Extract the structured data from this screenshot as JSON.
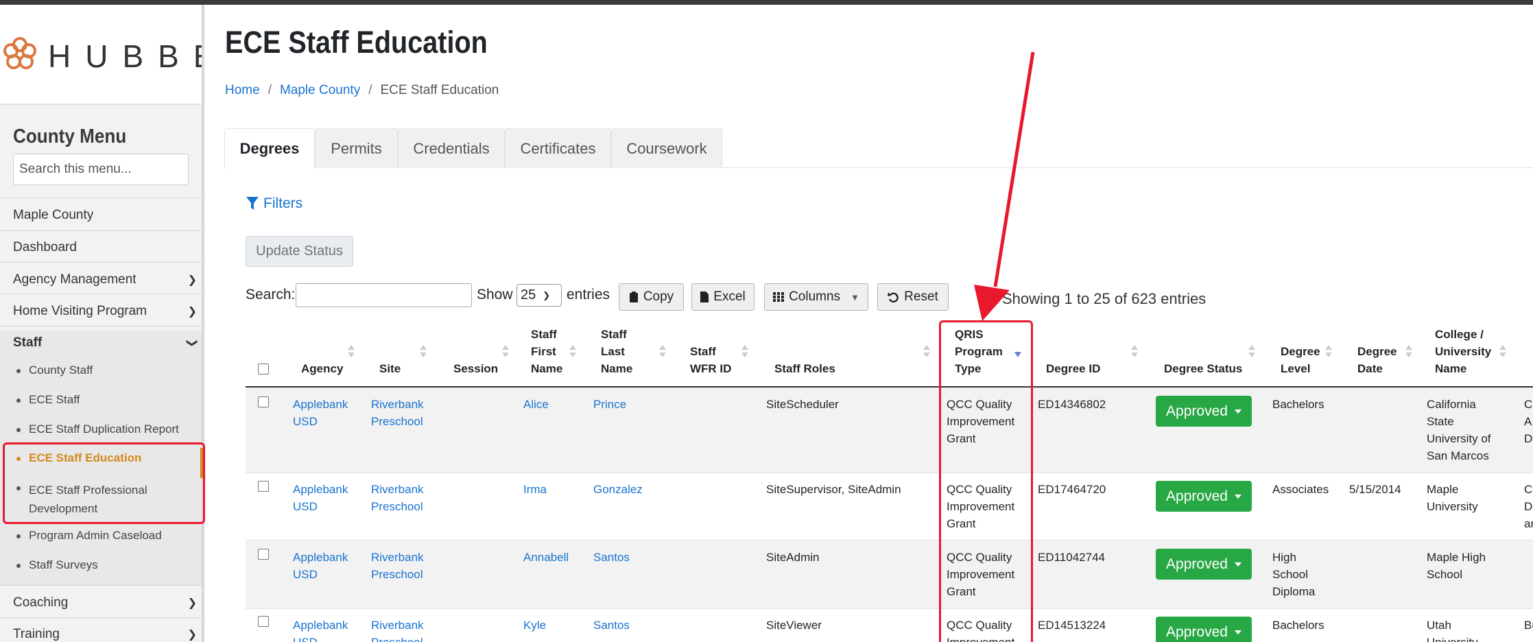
{
  "app": {
    "logo_text": "HUBBE"
  },
  "sidebar": {
    "title": "County Menu",
    "search_placeholder": "Search this menu...",
    "items": [
      {
        "label": "Maple County"
      },
      {
        "label": "Dashboard"
      },
      {
        "label": "Agency Management"
      },
      {
        "label": "Home Visiting Program"
      },
      {
        "label": "Staff"
      },
      {
        "label": "Coaching"
      },
      {
        "label": "Training"
      }
    ],
    "staff_sub": [
      {
        "label": "County Staff"
      },
      {
        "label": "ECE Staff"
      },
      {
        "label": "ECE Staff Duplication Report"
      },
      {
        "label": "ECE Staff Education"
      },
      {
        "label": "ECE Staff Professional Development"
      },
      {
        "label": "Program Admin Caseload"
      },
      {
        "label": "Staff Surveys"
      }
    ]
  },
  "page": {
    "title": "ECE Staff Education",
    "breadcrumb": [
      "Home",
      "Maple County",
      "ECE Staff Education"
    ]
  },
  "tabs": [
    "Degrees",
    "Permits",
    "Credentials",
    "Certificates",
    "Coursework"
  ],
  "toolbar": {
    "filters": "Filters",
    "update_status": "Update Status",
    "search_label": "Search:",
    "show_label": "Show",
    "show_value": "25",
    "entries_label": "entries",
    "copy": "Copy",
    "excel": "Excel",
    "columns": "Columns",
    "reset": "Reset",
    "info": "Showing 1 to 25 of 623 entries"
  },
  "table": {
    "headers": {
      "agency": "Agency",
      "site": "Site",
      "session": "Session",
      "first": [
        "Staff",
        "First",
        "Name"
      ],
      "last": [
        "Staff",
        "Last",
        "Name"
      ],
      "wfr": [
        "Staff",
        "WFR ID"
      ],
      "roles": "Staff Roles",
      "qris": [
        "QRIS",
        "Program",
        "Type"
      ],
      "degree_id": "Degree ID",
      "status": "Degree Status",
      "level": [
        "Degree",
        "Level"
      ],
      "date": [
        "Degree",
        "Date"
      ],
      "college": [
        "College /",
        "University",
        "Name"
      ]
    },
    "rows": [
      {
        "agency": [
          "Applebank",
          "USD"
        ],
        "site": [
          "Riverbank",
          "Preschool"
        ],
        "first": "Alice",
        "last": "Prince",
        "roles": "SiteScheduler",
        "qris": [
          "QCC Quality",
          "Improvement",
          "Grant"
        ],
        "degree_id": "ED14346802",
        "status": "Approved",
        "level": [
          "Bachelors"
        ],
        "date": "",
        "college": [
          "California",
          "State",
          "University of",
          "San Marcos"
        ],
        "extra": [
          "Cl",
          "A",
          "D"
        ]
      },
      {
        "agency": [
          "Applebank",
          "USD"
        ],
        "site": [
          "Riverbank",
          "Preschool"
        ],
        "first": "Irma",
        "last": "Gonzalez",
        "roles": "SiteSupervisor, SiteAdmin",
        "qris": [
          "QCC Quality",
          "Improvement",
          "Grant"
        ],
        "degree_id": "ED17464720",
        "status": "Approved",
        "level": [
          "Associates"
        ],
        "date": "5/15/2014",
        "college": [
          "Maple",
          "University"
        ],
        "extra": [
          "Cl",
          "D",
          "ar"
        ]
      },
      {
        "agency": [
          "Applebank",
          "USD"
        ],
        "site": [
          "Riverbank",
          "Preschool"
        ],
        "first": "Annabell",
        "last": "Santos",
        "roles": "SiteAdmin",
        "qris": [
          "QCC Quality",
          "Improvement",
          "Grant"
        ],
        "degree_id": "ED11042744",
        "status": "Approved",
        "level": [
          "High",
          "School",
          "Diploma"
        ],
        "date": "",
        "college": [
          "Maple High",
          "School"
        ],
        "extra": []
      },
      {
        "agency": [
          "Applebank",
          "USD"
        ],
        "site": [
          "Riverbank",
          "Preschool"
        ],
        "first": "Kyle",
        "last": "Santos",
        "roles": "SiteViewer",
        "qris": [
          "QCC Quality",
          "Improvement"
        ],
        "degree_id": "ED14513224",
        "status": "Approved",
        "level": [
          "Bachelors"
        ],
        "date": "",
        "college": [
          "Utah",
          "University"
        ],
        "extra": [
          "Bu"
        ]
      }
    ]
  },
  "colors": {
    "link": "#1a73d0",
    "active_menu": "#d2891b",
    "approved": "#28a745",
    "annotation": "#e8192c"
  }
}
